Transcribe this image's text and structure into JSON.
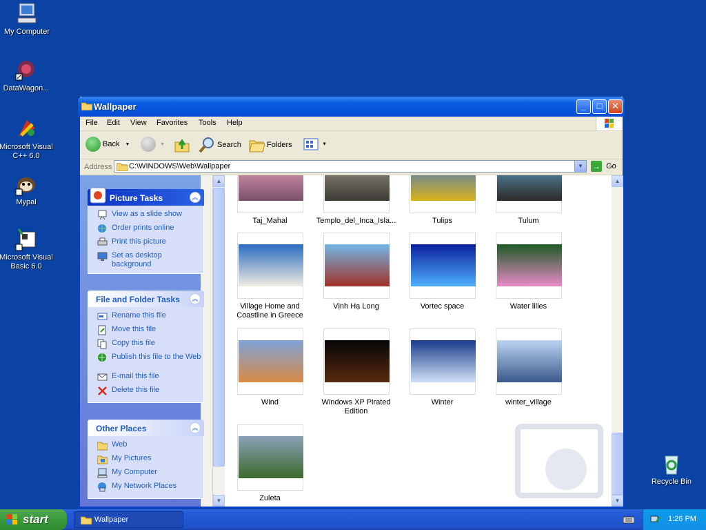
{
  "desktop": {
    "icons": [
      {
        "label": "My Computer",
        "icon": "my-computer-icon"
      },
      {
        "label": "DataWagon...",
        "icon": "datawagon-icon"
      },
      {
        "label": "Microsoft Visual C++ 6.0",
        "icon": "visual-cpp-icon"
      },
      {
        "label": "Mypal",
        "icon": "mypal-icon"
      },
      {
        "label": "Microsoft Visual Basic 6.0",
        "icon": "visual-basic-icon"
      },
      {
        "label": "Recycle Bin",
        "icon": "recycle-bin-icon"
      }
    ]
  },
  "window": {
    "title": "Wallpaper",
    "menu": [
      "File",
      "Edit",
      "View",
      "Favorites",
      "Tools",
      "Help"
    ],
    "toolbar": {
      "back": "Back",
      "search": "Search",
      "folders": "Folders"
    },
    "address": {
      "label": "Address",
      "value": "C:\\WINDOWS\\Web\\Wallpaper",
      "go": "Go"
    },
    "taskpane": {
      "picture_tasks": {
        "title": "Picture Tasks",
        "items": [
          "View as a slide show",
          "Order prints online",
          "Print this picture",
          "Set as desktop background"
        ]
      },
      "file_folder_tasks": {
        "title": "File and Folder Tasks",
        "items": [
          "Rename this file",
          "Move this file",
          "Copy this file",
          "Publish this file to the Web",
          "E-mail this file",
          "Delete this file"
        ]
      },
      "other_places": {
        "title": "Other Places",
        "items": [
          "Web",
          "My Pictures",
          "My Computer",
          "My Network Places"
        ]
      }
    },
    "files": [
      {
        "name": "Taj_Mahal",
        "colors": [
          "#e9a4b8",
          "#7a4f6c"
        ]
      },
      {
        "name": "Templo_del_Inca_Isla...",
        "colors": [
          "#9b968c",
          "#3d3a35"
        ]
      },
      {
        "name": "Tulips",
        "colors": [
          "#3b6fd0",
          "#d9b31c"
        ]
      },
      {
        "name": "Tulum",
        "colors": [
          "#5aa0c8",
          "#2e2a27"
        ]
      },
      {
        "name": "Village Home and Coastline in Greece",
        "colors": [
          "#2b6cc0",
          "#f0ece2"
        ]
      },
      {
        "name": "Vịnh Hạ Long",
        "colors": [
          "#72b6e8",
          "#a03026"
        ]
      },
      {
        "name": "Vortec space",
        "colors": [
          "#0a1f9a",
          "#4fb0ff"
        ]
      },
      {
        "name": "Water lilies",
        "colors": [
          "#1f5a26",
          "#e98bc8"
        ]
      },
      {
        "name": "Wind",
        "colors": [
          "#7fa2d8",
          "#d98a45"
        ]
      },
      {
        "name": "Windows XP Pirated Edition",
        "colors": [
          "#050505",
          "#5a2a10"
        ]
      },
      {
        "name": "Winter",
        "colors": [
          "#1a3c8a",
          "#cfe0f5"
        ]
      },
      {
        "name": "winter_village",
        "colors": [
          "#bcd4f2",
          "#3b5a8c"
        ]
      },
      {
        "name": "Zuleta",
        "colors": [
          "#8aa0b8",
          "#3c6a2c"
        ]
      }
    ]
  },
  "taskbar": {
    "start": "start",
    "window_button": "Wallpaper",
    "clock": "1:26 PM"
  }
}
